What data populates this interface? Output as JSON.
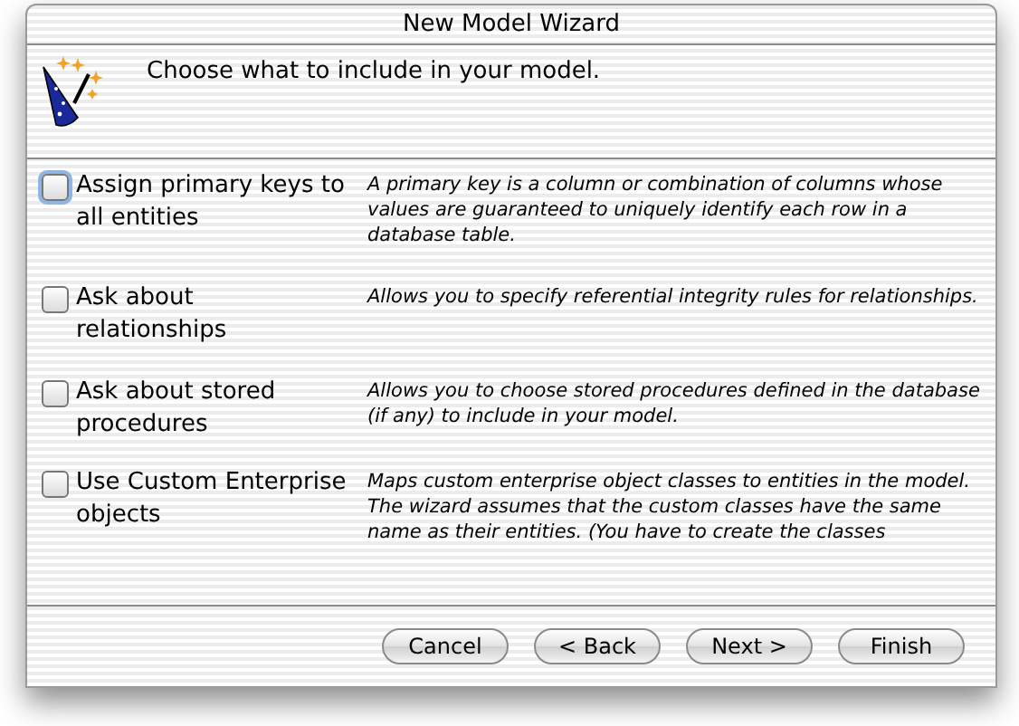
{
  "window": {
    "title": "New Model Wizard"
  },
  "header": {
    "instruction": "Choose what to include in your model."
  },
  "options": [
    {
      "label": "Assign primary keys to all entities",
      "checked": false,
      "focused": true,
      "description": "A primary key is a column or combination of columns whose values are guaranteed to uniquely identify each row in a database table."
    },
    {
      "label": "Ask about relationships",
      "checked": false,
      "focused": false,
      "description": "Allows you to specify referential integrity rules for relationships."
    },
    {
      "label": "Ask about stored procedures",
      "checked": false,
      "focused": false,
      "description": "Allows you to choose stored procedures defined in the database (if any) to include in your model."
    },
    {
      "label": "Use Custom Enterprise objects",
      "checked": false,
      "focused": false,
      "description": "Maps custom enterprise object classes to entities in the model. The wizard assumes that the custom classes have the same name as their entities. (You have to create the classes"
    }
  ],
  "buttons": [
    "Cancel",
    "< Back",
    "Next >",
    "Finish"
  ]
}
